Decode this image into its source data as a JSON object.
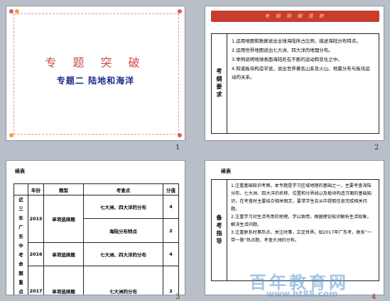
{
  "slides": [
    {
      "number": "1",
      "title": "专 题 突 破",
      "subtitle": "专题二   陆地和海洋"
    },
    {
      "number": "2",
      "header": "考 纲 明 细 清 单",
      "rowhead": "考纲要求",
      "items": [
        "1.运用地图和数据说出全球海陆所占比例，描述海陆分布特点。",
        "2.运用世界地图说出七大洲、四大洋的地理分布。",
        "3.举例说明地球表面海陆处在不断的运动和变化之中。",
        "4.知道板块构造学说，说出世界著名山系及火山、地震分布与板块运动的关系。"
      ]
    },
    {
      "number": "3",
      "label": "续表",
      "table": {
        "headers": [
          "近三年广东中考命题重点分析",
          "年份",
          "题型",
          "考查点",
          "分值"
        ],
        "rows": [
          {
            "year": "2015",
            "type": "单项选择题",
            "point": "七大洲、四大洋的分布",
            "score": "4"
          },
          {
            "year": "",
            "type": "",
            "point": "海陆分布特点",
            "score": "2"
          },
          {
            "year": "2016",
            "type": "单项选择题",
            "point": "七大洲、四大洋的分布",
            "score": "4"
          },
          {
            "year": "2017",
            "type": "单项选择题",
            "point": "七大洲的分布",
            "score": "2"
          }
        ]
      }
    },
    {
      "number": "4",
      "label": "续表",
      "rowhead": "备考指导",
      "items": [
        "1.注重基础知识考察。本专题是学习区域地理的基础之一，主要考查海陆分布、七大洲、四大洋的名称、位置和分界线以及板块构造方面的基础知识，在考查时主要结合相关图文，要求学生会从中提取信息完成相关问题。",
        "2.注重学习对生活有用的地理，学以致用，根据理论知识解析生活现象，解决生活问题。",
        "3.注重联系时事热点，关注时事，立足世界。如2017年广东考，联系“一带一路”热点题，考查大洲的分布。"
      ]
    }
  ],
  "watermark": {
    "big": "百年教育网",
    "small": "www.ht88.com"
  },
  "colors": {
    "background": "#b8bfc9",
    "title_red": "#d04a4a",
    "subtitle_blue": "#1a2a8a",
    "header_red": "#c73d2e"
  }
}
